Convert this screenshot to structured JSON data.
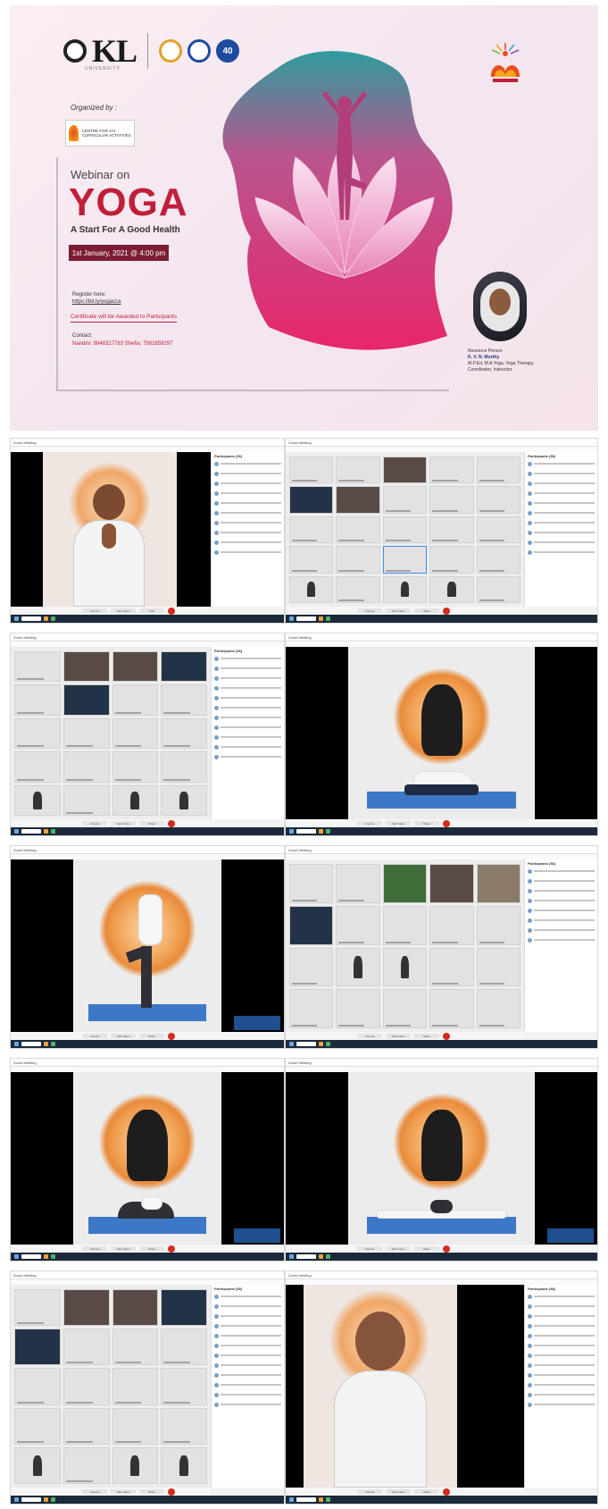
{
  "poster": {
    "kl_logo_text": "KL",
    "kl_sub": "UNIVERSITY",
    "badge_text": "40",
    "organized_by": "Organized by :",
    "organizer": "CENTRE FOR CO-CURRICULAR ACTIVITIES",
    "webinar_on": "Webinar on",
    "title": "YOGA",
    "tagline": "A Start For A Good Health",
    "date": "1st January, 2021 @ 4:00 pm",
    "register_label": "Register here:",
    "register_link": "https://bit.ly/yogaccа",
    "certificate": "Certificate will be Awarded to Participants",
    "contact_label": "Contact:",
    "contact_line": "Nandini: 9848327783 Shefla: 7981859297",
    "resource_label": "Resource Person",
    "resource_name": "K. V. N. Murthy",
    "resource_desc": "M.P.Ed, M.A Yoga, Yoga Therapy, Coordinator, Instructor"
  },
  "tiles": [
    {
      "window_title": "Zoom Meeting",
      "panel_title": "Participants (56)"
    },
    {
      "window_title": "Zoom Meeting",
      "panel_title": "Participants (56)"
    },
    {
      "window_title": "Zoom Meeting",
      "panel_title": "Participants (56)"
    },
    {
      "window_title": "Zoom Meeting",
      "panel_title": ""
    },
    {
      "window_title": "Zoom Meeting",
      "panel_title": ""
    },
    {
      "window_title": "Zoom Meeting",
      "panel_title": "Participants (56)"
    },
    {
      "window_title": "Zoom Meeting",
      "panel_title": ""
    },
    {
      "window_title": "Zoom Meeting",
      "panel_title": ""
    },
    {
      "window_title": "Zoom Meeting",
      "panel_title": "Participants (56)"
    },
    {
      "window_title": "Zoom Meeting",
      "panel_title": "Participants (56)"
    }
  ],
  "controls": {
    "mute": "Unmute",
    "video": "Start Video",
    "chat": "Chat",
    "share": "Share"
  },
  "colors": {
    "accent": "#c01f3a",
    "taskbar": "#1b2a3a",
    "mat": "#3d78c7"
  }
}
